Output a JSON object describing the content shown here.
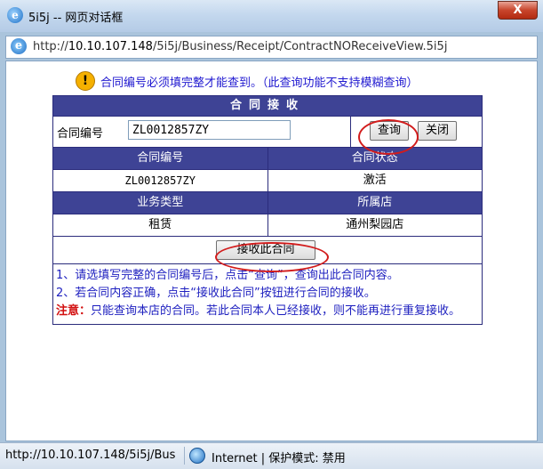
{
  "window": {
    "title": "5i5j -- 网页对话框",
    "close_label": "X",
    "url_prefix": "http://",
    "url_host": "10.10.107.148",
    "url_path": "/5i5j/Business/Receipt/ContractNOReceiveView.5i5j"
  },
  "notice": {
    "icon": "warning-icon",
    "text": "合同编号必须填完整才能查到。（此查询功能不支持模糊查询）"
  },
  "form": {
    "header": "合同接收",
    "contract_label": "合同编号",
    "contract_value": "ZL0012857ZY",
    "query_label": "查询",
    "close_label": "关闭"
  },
  "result": {
    "headers1": [
      "合同编号",
      "合同状态"
    ],
    "values1": [
      "ZL0012857ZY",
      "激活"
    ],
    "headers2": [
      "业务类型",
      "所属店"
    ],
    "values2": [
      "租赁",
      "通州梨园店"
    ],
    "accept_label": "接收此合同"
  },
  "instructions": {
    "line1": "1、请选填写完整的合同编号后，点击“查询”，查询出此合同内容。",
    "line2": "2、若合同内容正确，点击“接收此合同”按钮进行合同的接收。",
    "note_label": "注意：",
    "note_text": "只能查询本店的合同。若此合同本人已经接收，则不能再进行重复接收。"
  },
  "status": {
    "url": "http://10.10.107.148/5i5j/Bus",
    "zone": "Internet | 保护模式: 禁用"
  },
  "colors": {
    "header_bg": "#3e4395",
    "notice_text": "#2019d0",
    "highlight": "#d21c1c"
  }
}
